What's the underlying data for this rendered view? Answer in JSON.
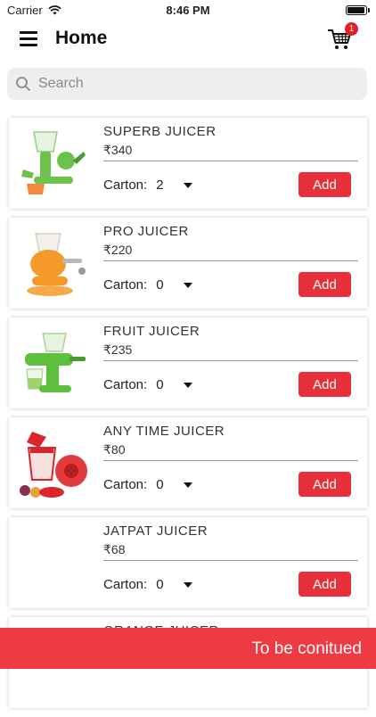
{
  "status_bar": {
    "carrier": "Carrier",
    "time": "8:46 PM",
    "battery_level": 1.0
  },
  "header": {
    "title": "Home",
    "cart_count": "1",
    "menu_icon": "hamburger-menu-icon",
    "cart_icon": "shopping-cart-icon"
  },
  "search": {
    "placeholder": "Search",
    "value": "",
    "icon": "search-icon"
  },
  "colors": {
    "accent": "#e8303a",
    "bottom_bar": "#ef3a43",
    "badge": "#e31e24"
  },
  "products": [
    {
      "name": "SUPERB JUICER",
      "price": "₹340",
      "carton_label": "Carton:",
      "carton_qty": "2",
      "add_label": "Add",
      "image_color": "#6cc24a"
    },
    {
      "name": "PRO JUICER",
      "price": "₹220",
      "carton_label": "Carton:",
      "carton_qty": "0",
      "add_label": "Add",
      "image_color": "#f39a2b"
    },
    {
      "name": "FRUIT JUICER",
      "price": "₹235",
      "carton_label": "Carton:",
      "carton_qty": "0",
      "add_label": "Add",
      "image_color": "#5fbf3f"
    },
    {
      "name": "ANY TIME JUICER",
      "price": "₹80",
      "carton_label": "Carton:",
      "carton_qty": "0",
      "add_label": "Add",
      "image_color": "#d9262c"
    },
    {
      "name": "JATPAT JUICER",
      "price": "₹68",
      "carton_label": "Carton:",
      "carton_qty": "0",
      "add_label": "Add",
      "image_color": ""
    },
    {
      "name": "ORANGE JUICER",
      "price": "",
      "carton_label": "",
      "carton_qty": "",
      "add_label": "",
      "image_color": ""
    }
  ],
  "bottom_bar": {
    "label": "To be conitued"
  }
}
